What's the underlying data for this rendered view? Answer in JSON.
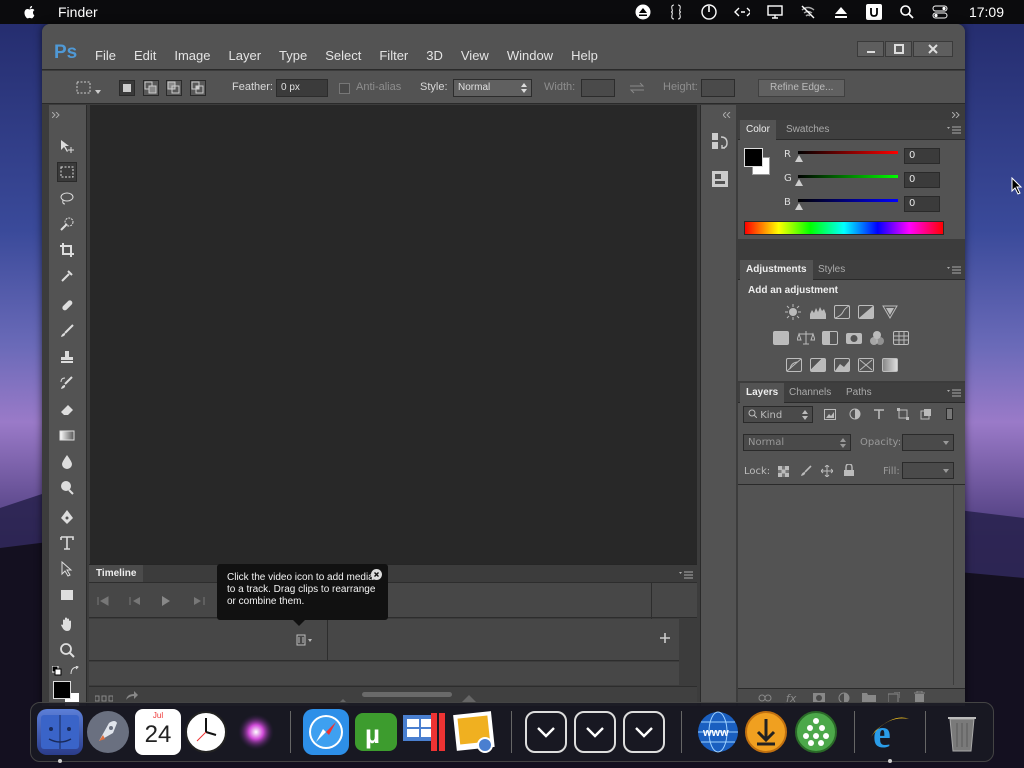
{
  "menubar": {
    "app_name": "Finder",
    "clock": "17:09"
  },
  "ps": {
    "logo": "Ps",
    "menu": [
      "File",
      "Edit",
      "Image",
      "Layer",
      "Type",
      "Select",
      "Filter",
      "3D",
      "View",
      "Window",
      "Help"
    ],
    "options": {
      "feather_label": "Feather:",
      "feather_value": "0 px",
      "antialias_label": "Anti-alias",
      "style_label": "Style:",
      "style_value": "Normal",
      "width_label": "Width:",
      "height_label": "Height:",
      "refine_edge": "Refine Edge..."
    },
    "timeline": {
      "tab": "Timeline",
      "tooltip": "Click the video icon to add media to a track. Drag clips to rearrange or combine them."
    },
    "color_panel": {
      "tabs": [
        "Color",
        "Swatches"
      ],
      "r_label": "R",
      "g_label": "G",
      "b_label": "B",
      "r_value": "0",
      "g_value": "0",
      "b_value": "0"
    },
    "adjustments_panel": {
      "tabs": [
        "Adjustments",
        "Styles"
      ],
      "title": "Add an adjustment"
    },
    "layers_panel": {
      "tabs": [
        "Layers",
        "Channels",
        "Paths"
      ],
      "kind": "Kind",
      "blend_mode": "Normal",
      "opacity_label": "Opacity:",
      "lock_label": "Lock:",
      "fill_label": "Fill:"
    }
  },
  "dock": {
    "calendar_month": "Jul",
    "calendar_day": "24"
  },
  "colors": {
    "ps_blue": "#4f99d6",
    "panel": "#535353",
    "canvas": "#282828"
  }
}
